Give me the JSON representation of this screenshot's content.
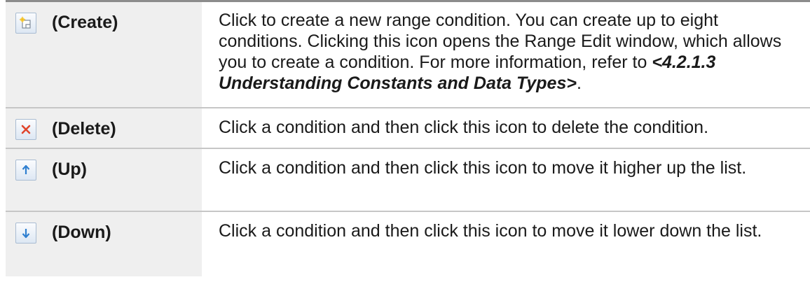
{
  "rows": [
    {
      "icon": "create-icon",
      "label": "(Create)",
      "desc": "Click to create a new range condition. You can create up to eight conditions. Clicking this icon opens the Range Edit window, which allows you to create a condition. For more information, refer to ",
      "ref": "<4.2.1.3 Understanding Constants and Data Types>",
      "tail": "."
    },
    {
      "icon": "delete-icon",
      "label": "(Delete)",
      "desc": "Click a condition and then click this icon to delete the condition."
    },
    {
      "icon": "up-arrow-icon",
      "label": "(Up)",
      "desc": "Click a condition and then click this icon to move it higher up the list."
    },
    {
      "icon": "down-arrow-icon",
      "label": "(Down)",
      "desc": "Click a condition and then click this icon to move it lower down the list."
    }
  ],
  "colors": {
    "header_border": "#8c8c8c",
    "row_border": "#c6c6c6",
    "left_cell_bg": "#efefef",
    "delete_red": "#e0452c",
    "arrow_blue": "#2f7fd0"
  }
}
